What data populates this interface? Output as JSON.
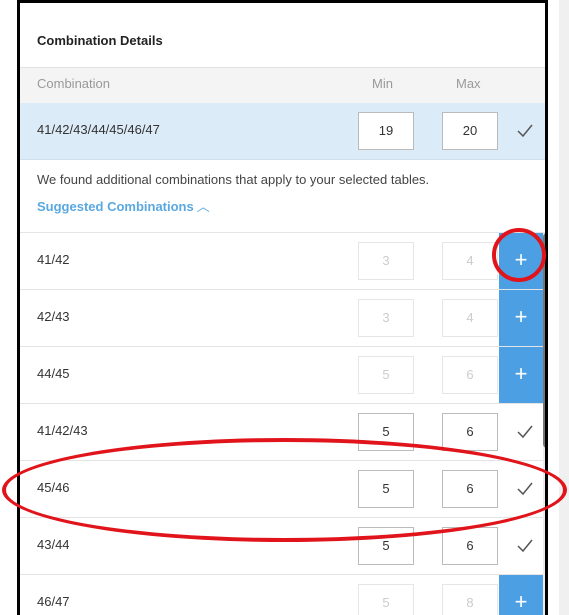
{
  "panel": {
    "title": "Combination Details",
    "columns": {
      "combination": "Combination",
      "min": "Min",
      "max": "Max"
    }
  },
  "selected": {
    "combination": "41/42/43/44/45/46/47",
    "min": "19",
    "max": "20"
  },
  "info_text": "We found additional combinations that apply to your selected tables.",
  "suggested_label": "Suggested Combinations",
  "rows": [
    {
      "combination": "41/42",
      "min": "3",
      "max": "4",
      "state": "add"
    },
    {
      "combination": "42/43",
      "min": "3",
      "max": "4",
      "state": "add"
    },
    {
      "combination": "44/45",
      "min": "5",
      "max": "6",
      "state": "add"
    },
    {
      "combination": "41/42/43",
      "min": "5",
      "max": "6",
      "state": "added"
    },
    {
      "combination": "45/46",
      "min": "5",
      "max": "6",
      "state": "added"
    },
    {
      "combination": "43/44",
      "min": "5",
      "max": "6",
      "state": "added"
    },
    {
      "combination": "46/47",
      "min": "5",
      "max": "8",
      "state": "add"
    }
  ],
  "icons": {
    "add": "plus-icon",
    "added": "checkmark-icon",
    "collapse": "chevron-up-icon"
  },
  "colors": {
    "accent": "#4d9fe4",
    "selected_row": "#dcebf8",
    "annotation": "#e0141a"
  }
}
